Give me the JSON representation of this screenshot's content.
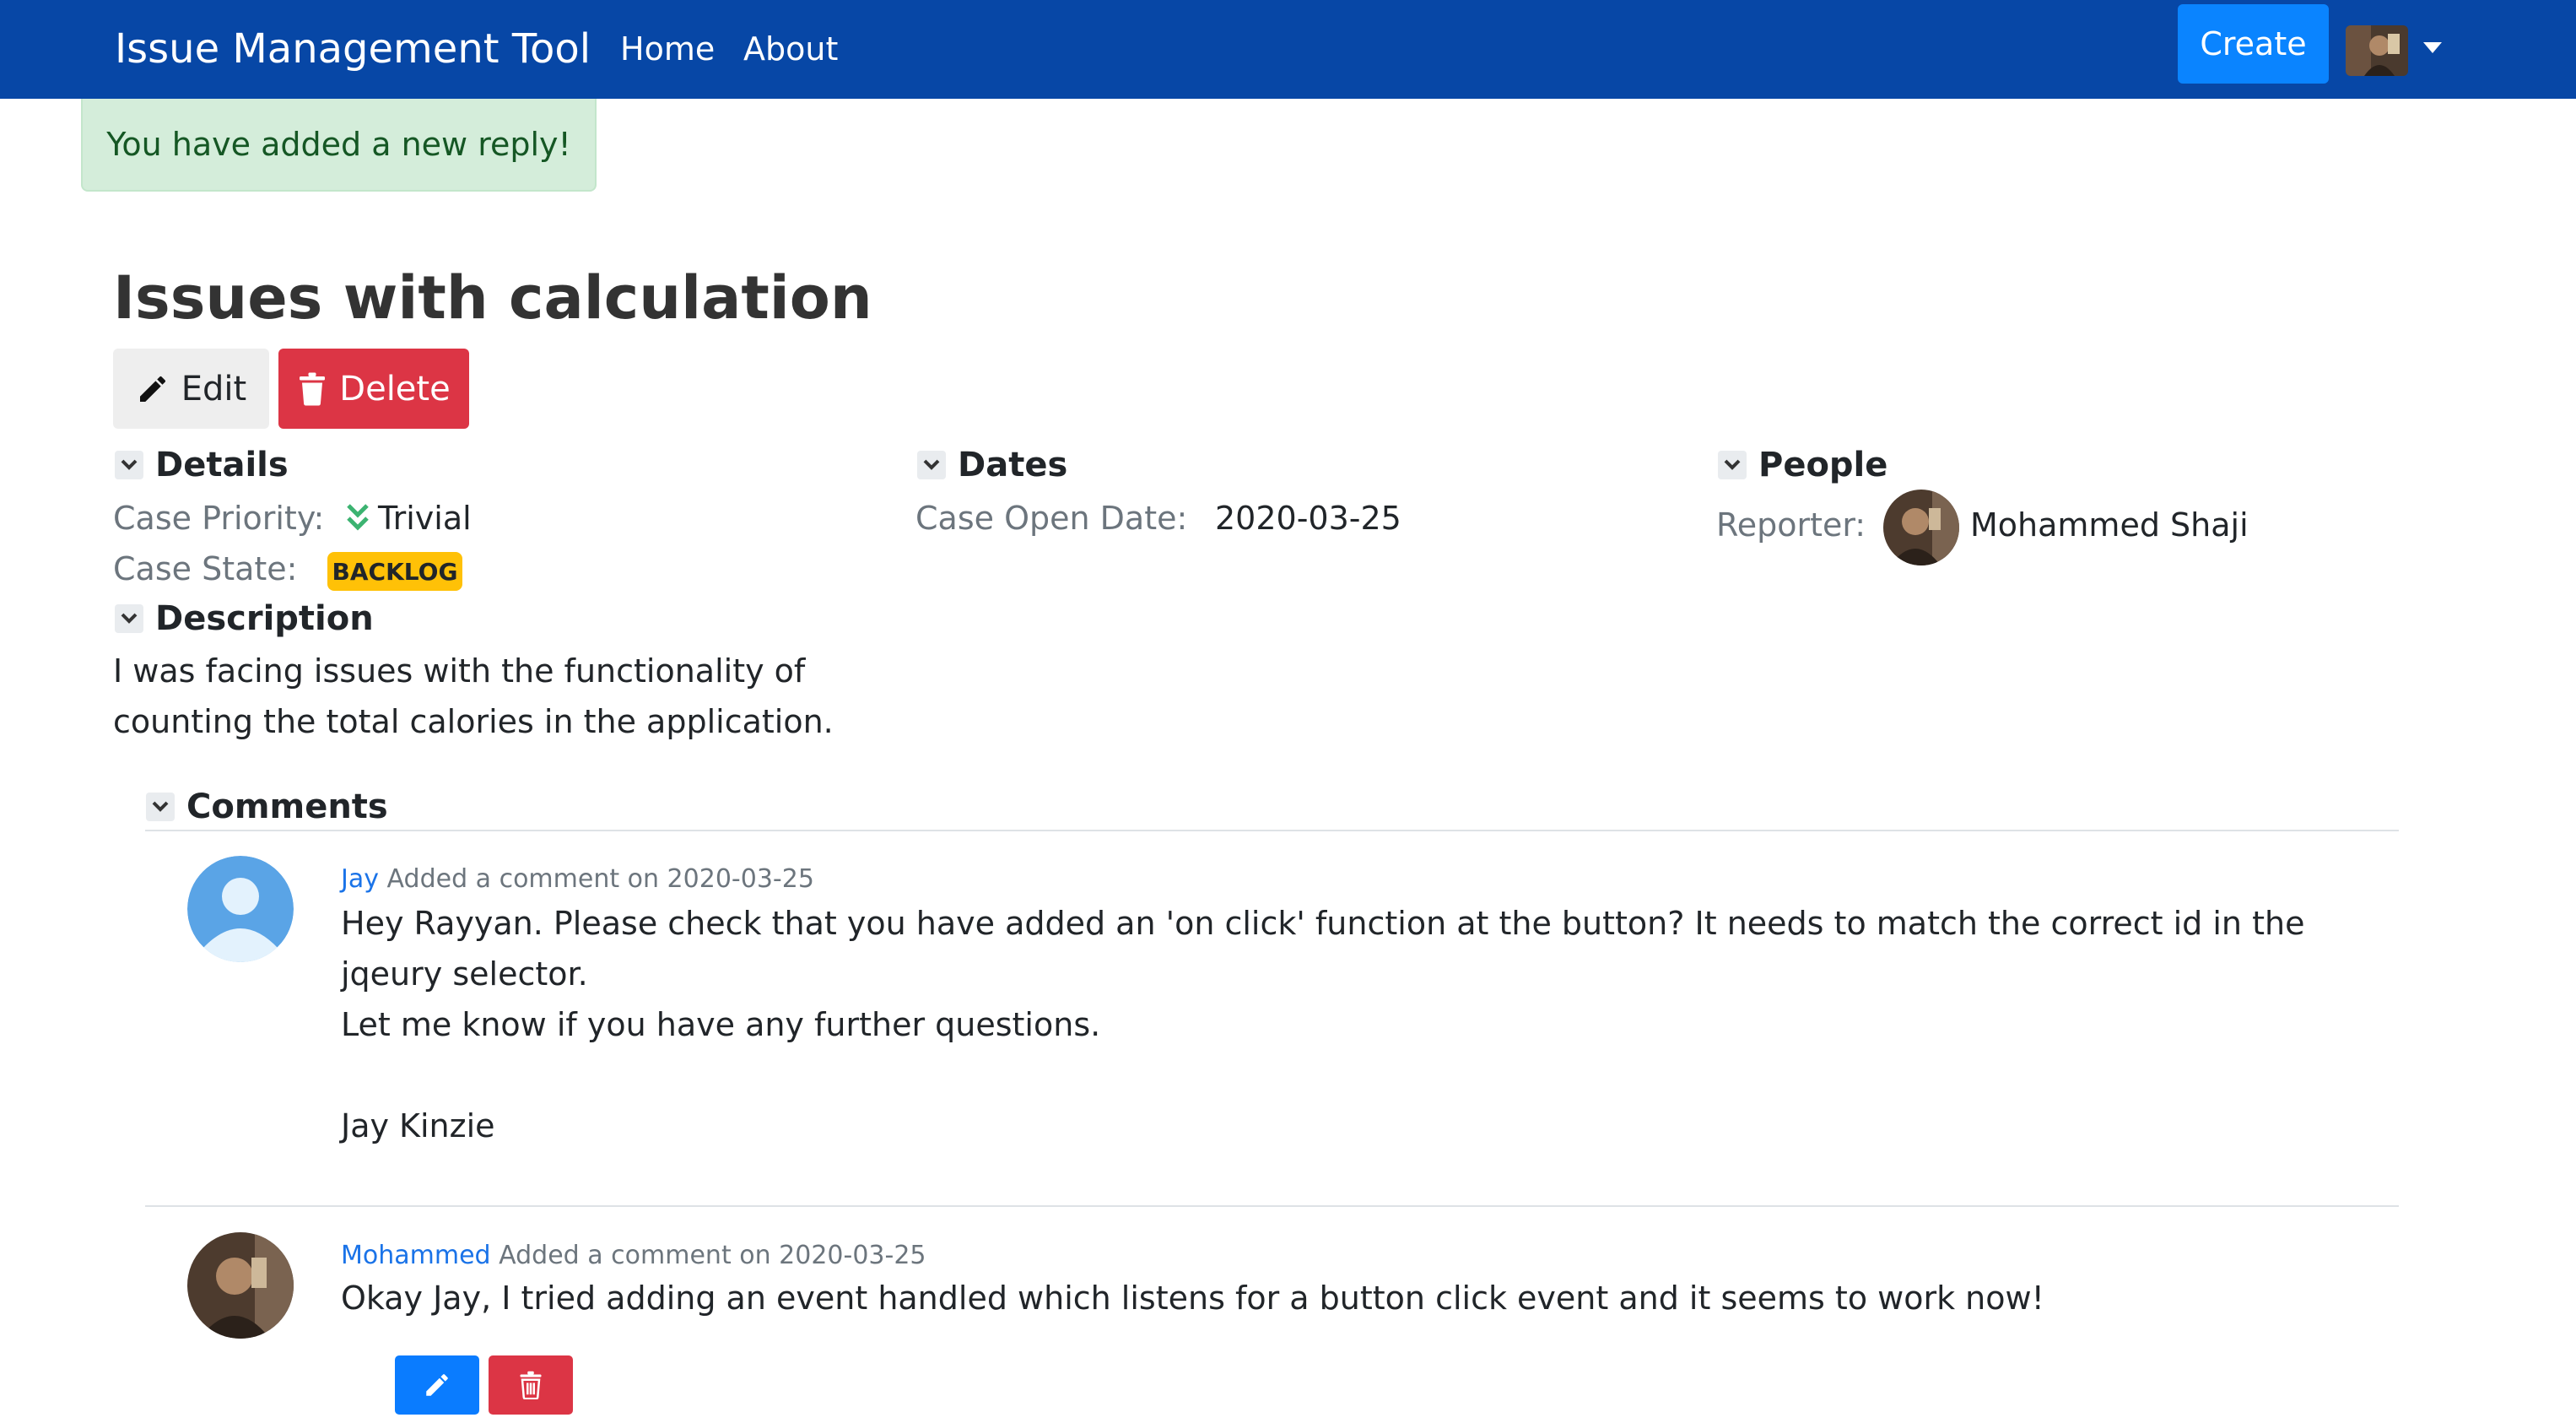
{
  "nav": {
    "brand": "Issue Management Tool",
    "links": [
      "Home",
      "About"
    ],
    "create_label": "Create"
  },
  "alert": {
    "message": "You have added a new reply!"
  },
  "issue": {
    "title": "Issues with calculation",
    "edit_label": "Edit",
    "delete_label": "Delete",
    "details": {
      "heading": "Details",
      "priority_label": "Case Priority:",
      "priority_value": "Trivial",
      "state_label": "Case State:",
      "state_value": "BACKLOG"
    },
    "dates": {
      "heading": "Dates",
      "open_label": "Case Open Date:",
      "open_value": "2020-03-25"
    },
    "people": {
      "heading": "People",
      "reporter_label": "Reporter:",
      "reporter_name": "Mohammed Shaji"
    },
    "description": {
      "heading": "Description",
      "text": "I was facing issues with the functionality of counting the total calories in the application."
    }
  },
  "comments": {
    "heading": "Comments",
    "items": [
      {
        "author": "Jay",
        "meta": "Added a comment on 2020-03-25",
        "line1": "Hey Rayyan. Please check that you have added an 'on click' function at the button? It needs to match the correct id in the jqeury selector.",
        "line2": "Let me know if you have any further questions.",
        "signature": "Jay Kinzie"
      },
      {
        "author": "Mohammed",
        "meta": "Added a comment on 2020-03-25",
        "line1": "Okay Jay, I tried adding an event handled which listens for a button click event and it seems to work now!"
      }
    ]
  },
  "colors": {
    "navbar": "#0747a6",
    "primary": "#0a84ff",
    "danger": "#dc3545",
    "warning": "#ffc107",
    "success_bg": "#d4edda",
    "link": "#1a73e8"
  },
  "icons": [
    "pencil-icon",
    "trash-icon",
    "chevron-down-icon",
    "double-chevron-down-icon",
    "user-placeholder-icon"
  ]
}
